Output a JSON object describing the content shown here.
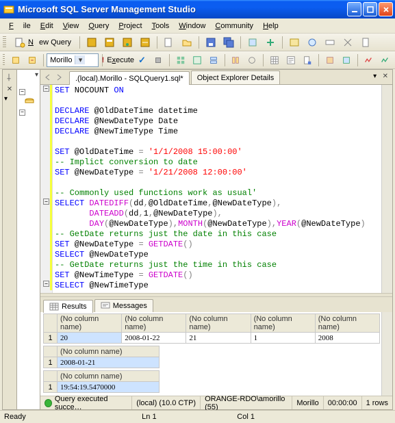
{
  "title": "Microsoft SQL Server Management Studio",
  "menu": {
    "file": "File",
    "edit": "Edit",
    "view": "View",
    "query": "Query",
    "project": "Project",
    "tools": "Tools",
    "window": "Window",
    "community": "Community",
    "help": "Help"
  },
  "toolbar1": {
    "newquery": "New Query"
  },
  "toolbar2": {
    "db": "Morillo",
    "execute": "Execute"
  },
  "tabs": {
    "active": ".(local).Morillo - SQLQuery1.sql*",
    "other": "Object Explorer Details"
  },
  "code": {
    "l1a": "SET",
    "l1b": " NOCOUNT ",
    "l1c": "ON",
    "l3a": "DECLARE",
    "l3b": " @OldDateTime datetime",
    "l4a": "DECLARE",
    "l4b": " @NewDateType Date",
    "l5a": "DECLARE",
    "l5b": " @NewTimeType Time",
    "l7a": "SET",
    "l7b": " @OldDateTime ",
    "l7c": "=",
    "l7d": " ",
    "l7e": "'1/1/2008 15:00:00'",
    "l8a": "-- Implict conversion to date",
    "l9a": "SET",
    "l9b": " @NewDateType ",
    "l9c": "=",
    "l9d": " ",
    "l9e": "'1/21/2008 12:00:00'",
    "l11a": "-- Commonly used functions work as usual'",
    "l12a": "SELECT",
    "l12b": " ",
    "l12c": "DATEDIFF",
    "l12d": "(",
    "l12e": "dd",
    "l12f": ",",
    "l12g": "@OldDateTime",
    "l12h": ",",
    "l12i": "@NewDateType",
    "l12j": "),",
    "l13a": "       ",
    "l13b": "DATEADD",
    "l13c": "(",
    "l13d": "dd",
    "l13e": ",",
    "l13f": "1",
    "l13g": ",",
    "l13h": "@NewDateType",
    "l13i": "),",
    "l14a": "       ",
    "l14b": "DAY",
    "l14c": "(",
    "l14d": "@NewDateType",
    "l14e": "),",
    "l14f": "MONTH",
    "l14g": "(",
    "l14h": "@NewDateType",
    "l14i": "),",
    "l14j": "YEAR",
    "l14k": "(",
    "l14l": "@NewDateType",
    "l14m": ")",
    "l15a": "-- GetDate returns just the date in this case",
    "l16a": "SET",
    "l16b": " @NewDateType ",
    "l16c": "=",
    "l16d": " ",
    "l16e": "GETDATE",
    "l16f": "()",
    "l17a": "SELECT",
    "l17b": " @NewDateType",
    "l18a": "-- GetDate returns just the time in this case",
    "l19a": "SET",
    "l19b": " @NewTimeType ",
    "l19c": "=",
    "l19d": " ",
    "l19e": "GETDATE",
    "l19f": "()",
    "l20a": "SELECT",
    "l20b": " @NewTimeType"
  },
  "results": {
    "tab_results": "Results",
    "tab_messages": "Messages",
    "nocol": "(No column name)",
    "g1": {
      "r": "1",
      "c1": "20",
      "c2": "2008-01-22",
      "c3": "21",
      "c4": "1",
      "c5": "2008"
    },
    "g2": {
      "r": "1",
      "c1": "2008-01-21"
    },
    "g3": {
      "r": "1",
      "c1": "19:54:19.5470000"
    }
  },
  "status": {
    "exec": "Query executed succe…",
    "server": "(local) (10.0 CTP)",
    "user": "ORANGE-RDO\\amorillo (55)",
    "db": "Morillo",
    "time": "00:00:00",
    "rows": "1 rows"
  },
  "appstatus": {
    "ready": "Ready",
    "ln": "Ln 1",
    "col": "Col 1"
  }
}
